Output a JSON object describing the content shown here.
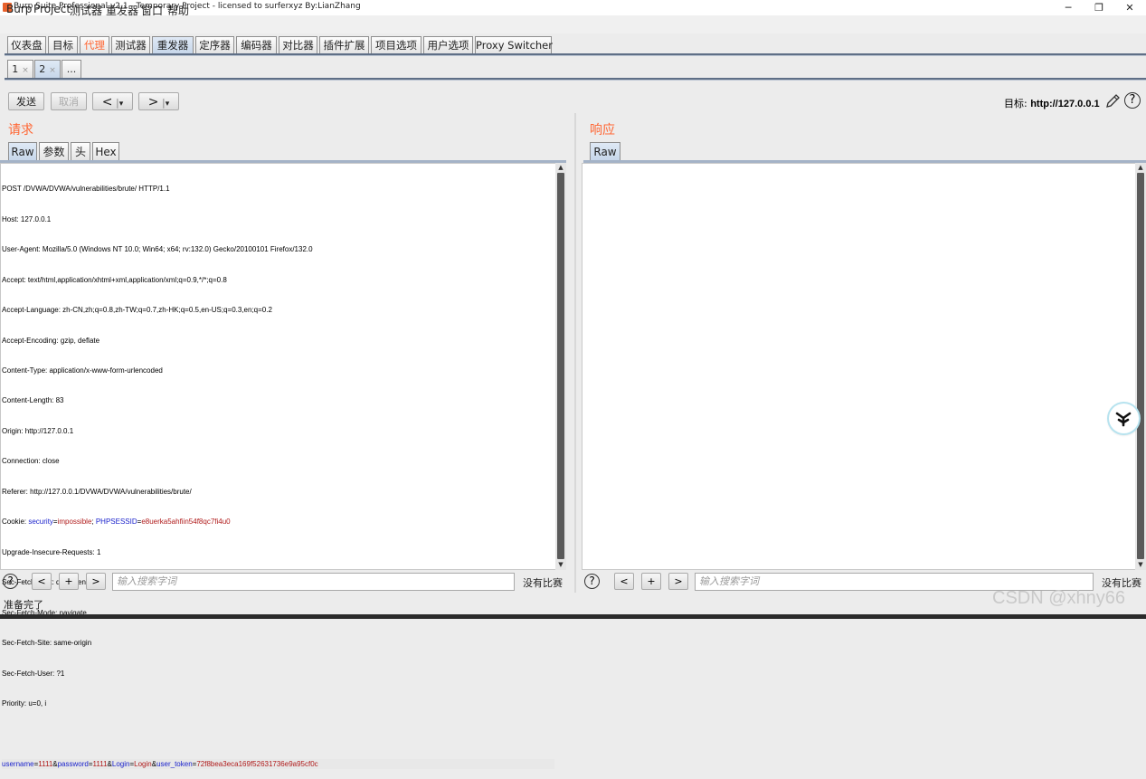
{
  "window": {
    "title": "Burp Suite Professional v2.1 - Temporary Project - licensed to surferxyz By:LianZhang",
    "minimize": "─",
    "maximize": "❐",
    "close": "✕"
  },
  "menu": [
    "Burp",
    "Project",
    "测试器",
    "重发器",
    "窗口",
    "帮助"
  ],
  "main_tabs": [
    "仪表盘",
    "目标",
    "代理",
    "测试器",
    "重发器",
    "定序器",
    "编码器",
    "对比器",
    "插件扩展",
    "项目选项",
    "用户选项",
    "Proxy Switcher"
  ],
  "main_tab_selected": "重发器",
  "sub_tabs": [
    {
      "label": "1",
      "close": "×"
    },
    {
      "label": "2",
      "close": "×"
    },
    {
      "label": "...",
      "close": ""
    }
  ],
  "toolbar": {
    "send": "发送",
    "cancel": "取消",
    "back": "<",
    "forward": ">",
    "dropdown": "▾",
    "target_prefix": "目标: ",
    "target_value": "http://127.0.0.1",
    "help": "?"
  },
  "request": {
    "title": "请求",
    "tabs": [
      "Raw",
      "参数",
      "头",
      "Hex"
    ],
    "lines": [
      "POST /DVWA/DVWA/vulnerabilities/brute/ HTTP/1.1",
      "Host: 127.0.0.1",
      "User-Agent: Mozilla/5.0 (Windows NT 10.0; Win64; x64; rv:132.0) Gecko/20100101 Firefox/132.0",
      "Accept: text/html,application/xhtml+xml,application/xml;q=0.9,*/*;q=0.8",
      "Accept-Language: zh-CN,zh;q=0.8,zh-TW;q=0.7,zh-HK;q=0.5,en-US;q=0.3,en;q=0.2",
      "Accept-Encoding: gzip, deflate",
      "Content-Type: application/x-www-form-urlencoded",
      "Content-Length: 83",
      "Origin: http://127.0.0.1",
      "Connection: close",
      "Referer: http://127.0.0.1/DVWA/DVWA/vulnerabilities/brute/"
    ],
    "cookie": {
      "prefix": "Cookie: ",
      "k1": "security",
      "v1": "impossible",
      "sep": "; ",
      "k2": "PHPSESSID",
      "v2": "e8uerka5ahfiin54f8qc7fi4u0"
    },
    "lines2": [
      "Upgrade-Insecure-Requests: 1",
      "Sec-Fetch-Dest: document",
      "Sec-Fetch-Mode: navigate",
      "Sec-Fetch-Site: same-origin",
      "Sec-Fetch-User: ?1",
      "Priority: u=0, i"
    ],
    "body": {
      "k1": "username",
      "v1": "1111",
      "k2": "password",
      "v2": "1111",
      "k3": "Login",
      "v3": "Login",
      "k4": "user_token",
      "v4": "72f8bea3eca169f52631736e9a95cf0c",
      "eq": "=",
      "amp": "&"
    }
  },
  "response": {
    "title": "响应",
    "tabs": [
      "Raw"
    ]
  },
  "search": {
    "help": "?",
    "prev": "<",
    "add": "+",
    "next": ">",
    "placeholder": "输入搜索字词",
    "no_match": "没有比赛"
  },
  "status": "准备完了",
  "watermark": "CSDN @xhny66",
  "colors": {
    "accent_orange": "#ff6633",
    "param_name": "#1a22cc",
    "param_value": "#b01b1b",
    "selected_tab": "#c7d7ea"
  }
}
